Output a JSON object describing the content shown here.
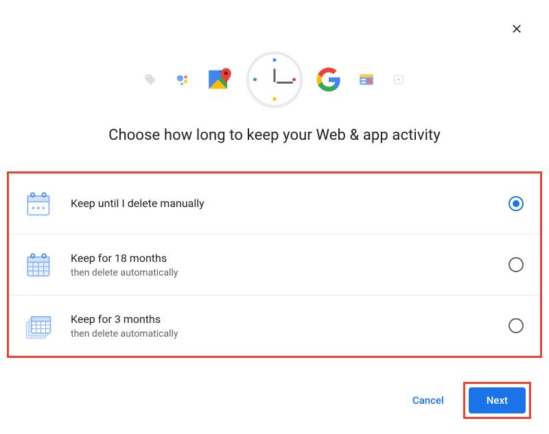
{
  "title": "Choose how long to keep your Web & app activity",
  "options": [
    {
      "label": "Keep until I delete manually",
      "sub": "",
      "selected": true
    },
    {
      "label": "Keep for 18 months",
      "sub": "then delete automatically",
      "selected": false
    },
    {
      "label": "Keep for 3 months",
      "sub": "then delete automatically",
      "selected": false
    }
  ],
  "buttons": {
    "cancel": "Cancel",
    "next": "Next"
  }
}
